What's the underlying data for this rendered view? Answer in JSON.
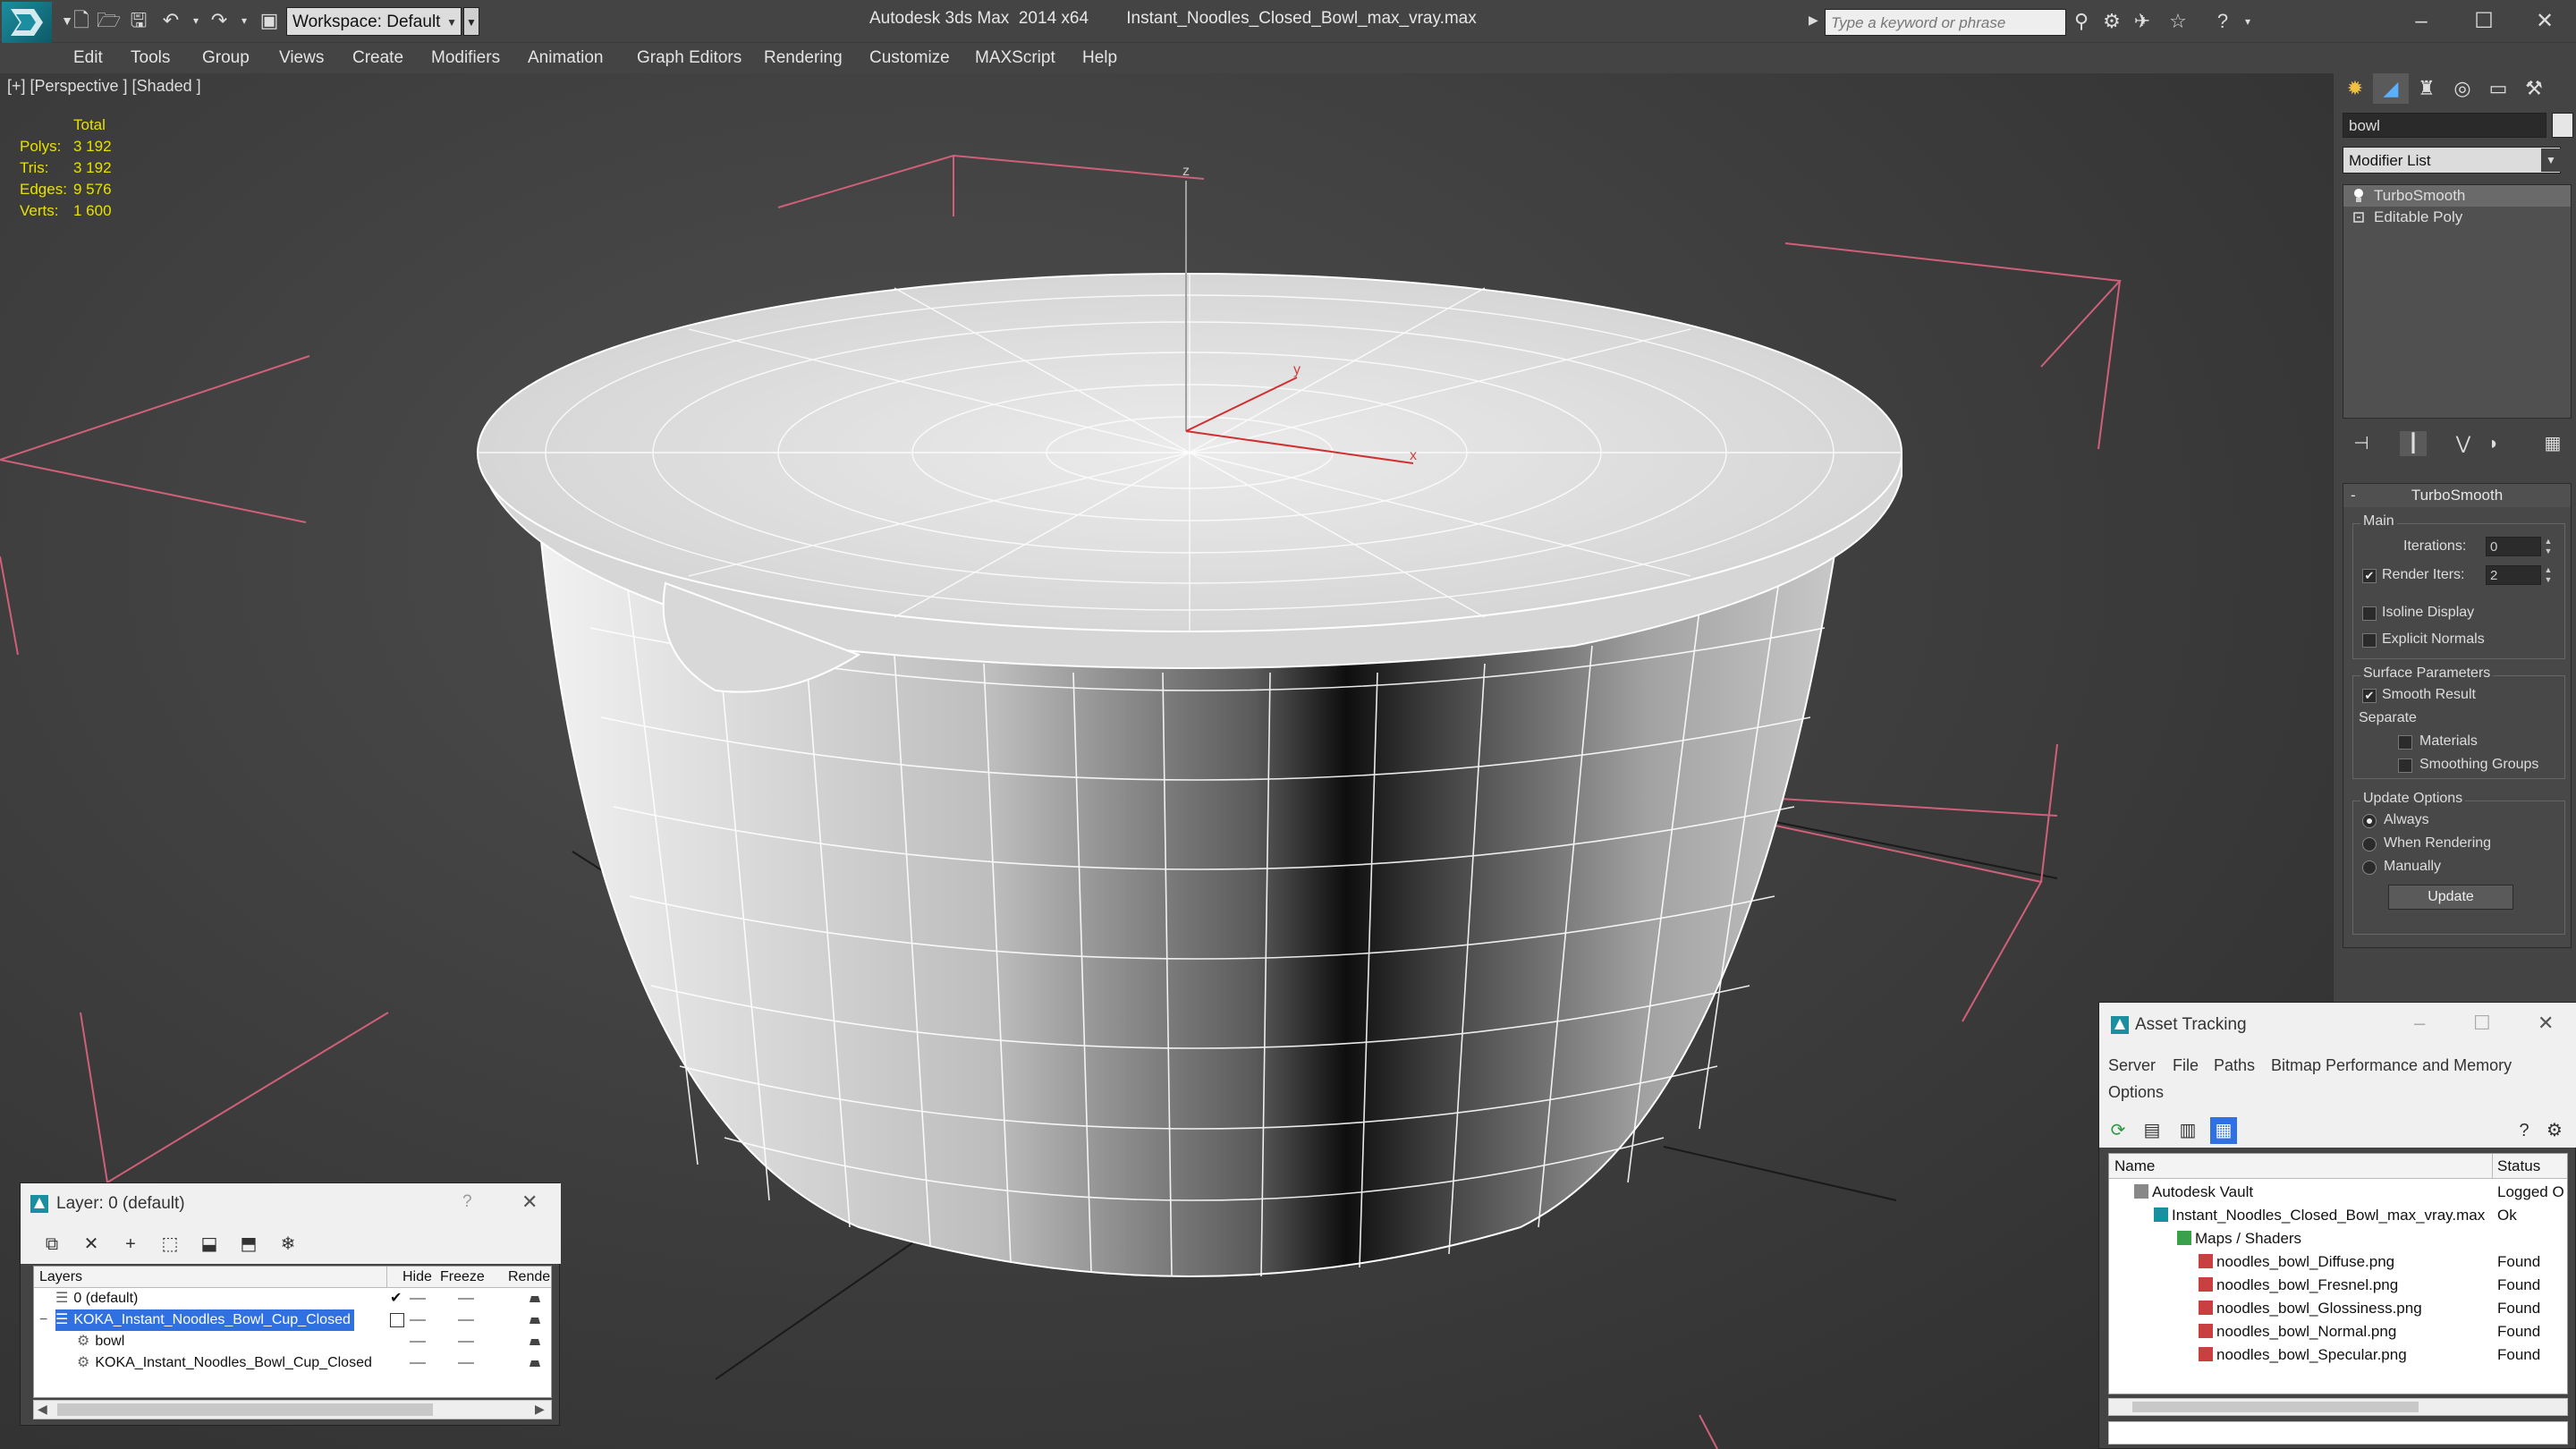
{
  "app": {
    "title": "Autodesk 3ds Max  2014 x64",
    "file": "Instant_Noodles_Closed_Bowl_max_vray.max",
    "workspace": "Workspace: Default",
    "search_placeholder": "Type a keyword or phrase"
  },
  "menu": [
    "Edit",
    "Tools",
    "Group",
    "Views",
    "Create",
    "Modifiers",
    "Animation",
    "Graph Editors",
    "Rendering",
    "Customize",
    "MAXScript",
    "Help"
  ],
  "viewport": {
    "label": "[+] [Perspective ] [Shaded ]",
    "stats_header": "Total",
    "stats": [
      {
        "k": "Polys:",
        "v": "3 192"
      },
      {
        "k": "Tris:",
        "v": "3 192"
      },
      {
        "k": "Edges:",
        "v": "9 576"
      },
      {
        "k": "Verts:",
        "v": "1 600"
      }
    ],
    "axes": {
      "x": "x",
      "y": "y",
      "z": "z"
    }
  },
  "command_panel": {
    "object_name": "bowl",
    "modifier_list": "Modifier List",
    "stack": [
      "TurboSmooth",
      "Editable Poly"
    ],
    "rollout_title": "TurboSmooth",
    "main_group": "Main",
    "iterations_label": "Iterations:",
    "iterations_value": "0",
    "render_iters_label": "Render Iters:",
    "render_iters_value": "2",
    "isoline": "Isoline Display",
    "explicit_normals": "Explicit Normals",
    "surface_group": "Surface Parameters",
    "smooth_result": "Smooth Result",
    "separate": "Separate",
    "materials": "Materials",
    "smoothing_groups": "Smoothing Groups",
    "update_group": "Update Options",
    "always": "Always",
    "when_rendering": "When Rendering",
    "manually": "Manually",
    "update_button": "Update"
  },
  "asset_tracking": {
    "title": "Asset Tracking",
    "menu": [
      "Server",
      "File",
      "Paths",
      "Bitmap Performance and Memory",
      "Options"
    ],
    "col_name": "Name",
    "col_status": "Status",
    "rows": [
      {
        "name": "Autodesk Vault",
        "status": "Logged O"
      },
      {
        "name": "Instant_Noodles_Closed_Bowl_max_vray.max",
        "status": "Ok"
      },
      {
        "name": "Maps / Shaders",
        "status": ""
      },
      {
        "name": "noodles_bowl_Diffuse.png",
        "status": "Found"
      },
      {
        "name": "noodles_bowl_Fresnel.png",
        "status": "Found"
      },
      {
        "name": "noodles_bowl_Glossiness.png",
        "status": "Found"
      },
      {
        "name": "noodles_bowl_Normal.png",
        "status": "Found"
      },
      {
        "name": "noodles_bowl_Specular.png",
        "status": "Found"
      }
    ]
  },
  "layer_dialog": {
    "title": "Layer: 0 (default)",
    "help": "?",
    "cols": [
      "Layers",
      "Hide",
      "Freeze",
      "Rende"
    ],
    "rows": [
      {
        "name": "0 (default)"
      },
      {
        "name": "KOKA_Instant_Noodles_Bowl_Cup_Closed"
      },
      {
        "name": "bowl"
      },
      {
        "name": "KOKA_Instant_Noodles_Bowl_Cup_Closed"
      }
    ]
  },
  "colors": {
    "stats_yellow": "#e8e000",
    "grid_pink": "#e06080",
    "selection_blue": "#3070e0",
    "logo_teal": "#1b8ea0"
  }
}
